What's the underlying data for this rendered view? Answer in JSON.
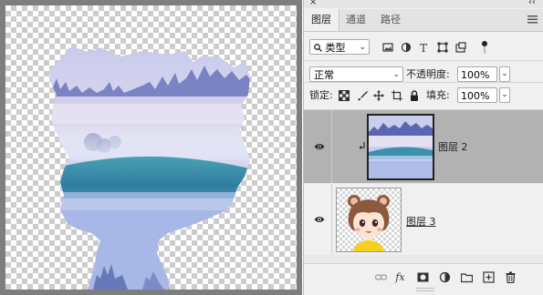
{
  "panel": {
    "close": "×",
    "collapse": "‹‹",
    "tabs": [
      {
        "label": "图层",
        "active": true
      },
      {
        "label": "通道",
        "active": false
      },
      {
        "label": "路径",
        "active": false
      }
    ],
    "menu_icon": "hamburger-menu-icon"
  },
  "filter": {
    "kind_label": "类型",
    "icons": [
      "image-filter-icon",
      "adjustment-filter-icon",
      "type-filter-icon",
      "shape-filter-icon",
      "smart-object-filter-icon"
    ]
  },
  "blend": {
    "mode": "正常",
    "opacity_label": "不透明度:",
    "opacity_value": "100%"
  },
  "lock": {
    "label": "锁定:",
    "icons": [
      "lock-transparent-pixels-icon",
      "lock-image-pixels-icon",
      "lock-position-icon",
      "lock-artboard-icon",
      "lock-all-icon"
    ],
    "fill_label": "填充:",
    "fill_value": "100%"
  },
  "layers": [
    {
      "name": "图层 2",
      "visible": true,
      "clipped": true,
      "selected": true,
      "thumb": "misty-landscape"
    },
    {
      "name": "图层 3",
      "visible": true,
      "clipped": false,
      "selected": false,
      "thumb": "cartoon-girl"
    }
  ],
  "bottom_icons": [
    "link-layers-icon",
    "fx-icon",
    "add-mask-icon",
    "adjustment-layer-icon",
    "new-group-icon",
    "new-layer-icon",
    "delete-layer-icon"
  ],
  "colors": {
    "selected_layer": "#b2b2b2",
    "panel_bg": "#f0f0f0",
    "canvas_frame": "#7e7e7e"
  }
}
